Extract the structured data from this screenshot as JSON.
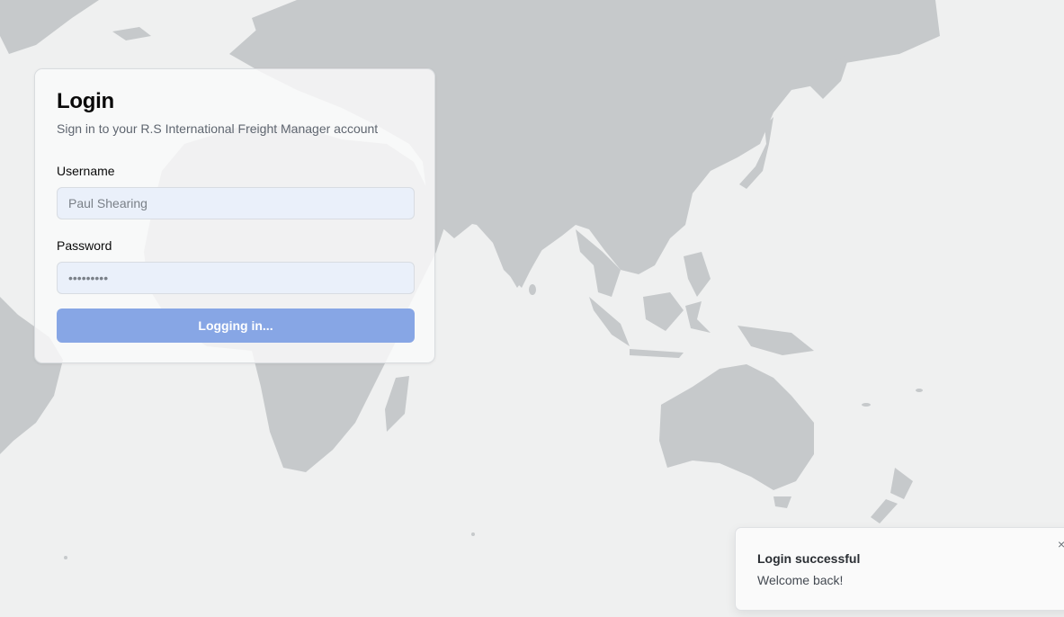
{
  "login": {
    "title": "Login",
    "subtitle": "Sign in to your R.S International Freight Manager account",
    "username_label": "Username",
    "username_value": "Paul Shearing",
    "password_label": "Password",
    "password_value": "•••••••••",
    "submit_label": "Logging in..."
  },
  "toast": {
    "title": "Login successful",
    "message": "Welcome back!",
    "close_icon": "×"
  },
  "colors": {
    "background": "#eff0f0",
    "land": "#c6c9cb",
    "button": "#87a6e5",
    "input_bg": "#eaf0fa"
  }
}
